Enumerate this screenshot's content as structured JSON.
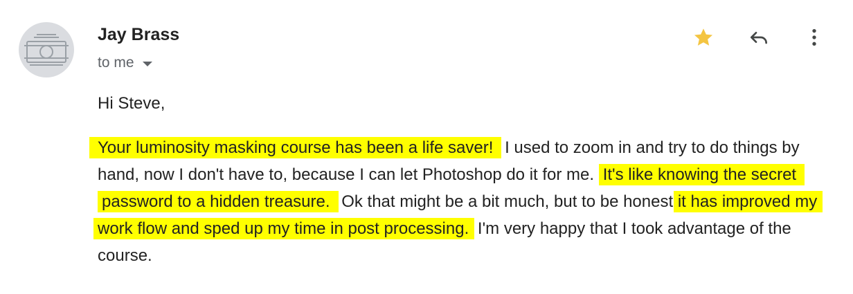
{
  "sender": {
    "name": "Jay Brass",
    "avatar_icon": "camera-icon"
  },
  "recipient": {
    "label": "to me",
    "dropdown_icon": "caret-down-icon"
  },
  "actions": {
    "star_icon": "star-icon",
    "star_color": "#f4c542",
    "reply_icon": "reply-icon",
    "more_icon": "more-vert-icon"
  },
  "message": {
    "greeting": "Hi Steve,",
    "segments": {
      "s1": "Your luminosity masking course has been a life saver!",
      "s2": " I used to zoom in and try to do things by hand, now I don't have to, because I can let Photoshop do it for me. ",
      "s3": "It's like knowing the secret password to a hidden treasure.",
      "s4": " Ok that might be a bit much, but to be honest,",
      "s5": "it has improved my work flow and sped up my time in post processing.",
      "s6": " I'm very happy that I took advantage of the course."
    },
    "highlight_color": "#ffff00"
  }
}
